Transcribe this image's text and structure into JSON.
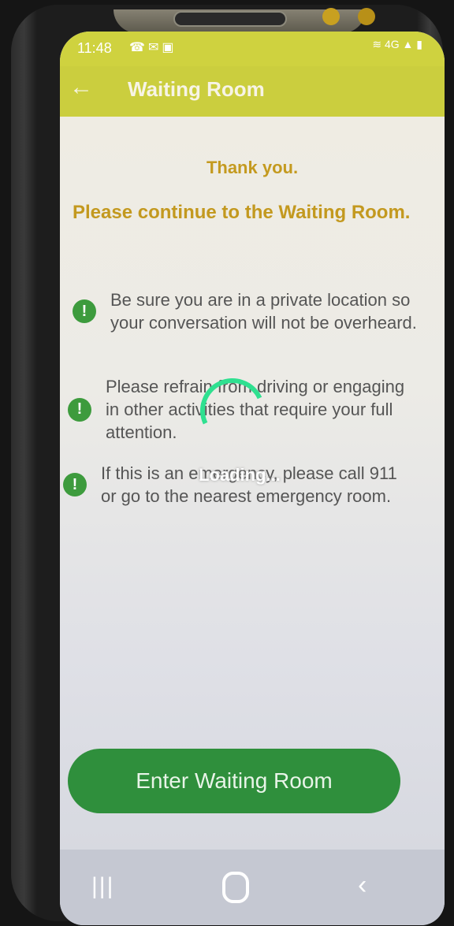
{
  "status_bar": {
    "time": "11:48",
    "left_icons": [
      "wifi-calling-icon",
      "message-icon",
      "image-icon"
    ],
    "right_icons": [
      "wifi-icon",
      "4g-icon",
      "signal-icon",
      "battery-icon"
    ]
  },
  "app_bar": {
    "title": "Waiting Room",
    "back_icon": "arrow-left-icon"
  },
  "content": {
    "thanks": "Thank you.",
    "continue": "Please continue to the Waiting Room.",
    "tips": [
      {
        "icon": "exclamation-icon",
        "text": "Be sure you are in a private location so your conversation will not be overheard."
      },
      {
        "icon": "exclamation-icon",
        "text": "Please refrain from driving or engaging in other activities that require your full attention."
      },
      {
        "icon": "exclamation-icon",
        "text": "If this is an emergency, please call 911 or go to the nearest emergency room."
      }
    ]
  },
  "loading": {
    "label": "Loading..."
  },
  "button": {
    "label": "Enter Waiting Room"
  },
  "nav_bar": {
    "recent_icon": "recent-apps-icon",
    "home_icon": "home-icon",
    "back_icon": "back-icon"
  },
  "colors": {
    "app_bar": "#cbce3e",
    "heading": "#c49a1f",
    "button": "#2f8f3c",
    "tip_icon": "#3d9b3d",
    "spinner": "#2fe090"
  }
}
